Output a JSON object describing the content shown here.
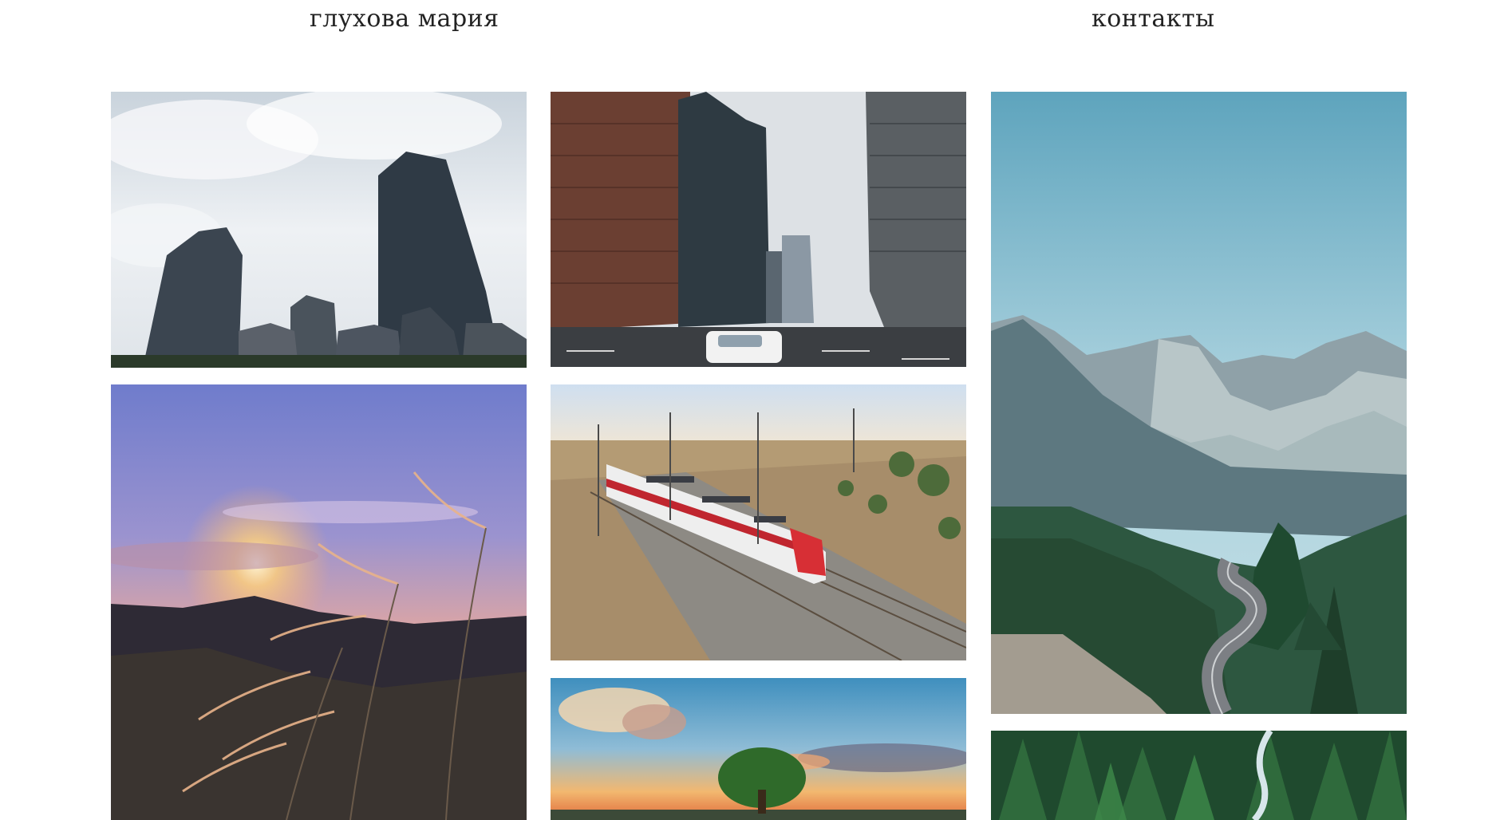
{
  "nav": {
    "name_link": "глухова мария",
    "contacts_link": "контакты"
  },
  "gallery": {
    "photos": [
      {
        "id": "skyscrapers-low-angle",
        "subject": "Skyscrapers against cloudy sky"
      },
      {
        "id": "grass-sunset",
        "subject": "Grass plumes at sunset over valley"
      },
      {
        "id": "city-street",
        "subject": "City street with high-rise towers and moving car"
      },
      {
        "id": "train",
        "subject": "Red and white passenger train on railway tracks"
      },
      {
        "id": "tree-sunset",
        "subject": "Lone tree at sunset"
      },
      {
        "id": "mountains",
        "subject": "Mountain valley with winding road and pine forest"
      },
      {
        "id": "forest-aerial",
        "subject": "Aerial view of pine forest with stream"
      }
    ]
  },
  "colors": {
    "background": "#ffffff",
    "nav_text": "#222222"
  }
}
